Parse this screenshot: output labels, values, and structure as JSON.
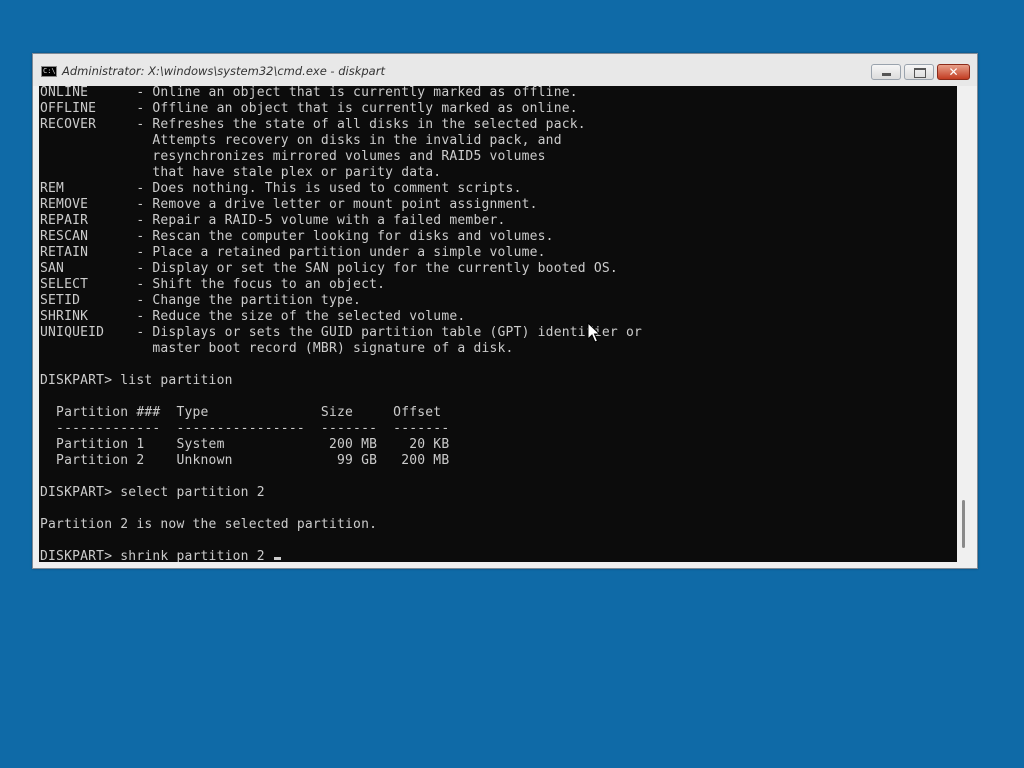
{
  "window": {
    "title": "Administrator: X:\\windows\\system32\\cmd.exe - diskpart",
    "icon_label": "C:\\",
    "close_glyph": "✕"
  },
  "console": {
    "lines": [
      "ONLINE      - Online an object that is currently marked as offline.",
      "OFFLINE     - Offline an object that is currently marked as online.",
      "RECOVER     - Refreshes the state of all disks in the selected pack.",
      "              Attempts recovery on disks in the invalid pack, and",
      "              resynchronizes mirrored volumes and RAID5 volumes",
      "              that have stale plex or parity data.",
      "REM         - Does nothing. This is used to comment scripts.",
      "REMOVE      - Remove a drive letter or mount point assignment.",
      "REPAIR      - Repair a RAID-5 volume with a failed member.",
      "RESCAN      - Rescan the computer looking for disks and volumes.",
      "RETAIN      - Place a retained partition under a simple volume.",
      "SAN         - Display or set the SAN policy for the currently booted OS.",
      "SELECT      - Shift the focus to an object.",
      "SETID       - Change the partition type.",
      "SHRINK      - Reduce the size of the selected volume.",
      "UNIQUEID    - Displays or sets the GUID partition table (GPT) identifier or",
      "              master boot record (MBR) signature of a disk.",
      "",
      "DISKPART> list partition",
      "",
      "  Partition ###  Type              Size     Offset",
      "  -------------  ----------------  -------  -------",
      "  Partition 1    System             200 MB    20 KB",
      "  Partition 2    Unknown             99 GB   200 MB",
      "",
      "DISKPART> select partition 2",
      "",
      "Partition 2 is now the selected partition.",
      ""
    ],
    "prompt_line": "DISKPART> shrink partition 2 "
  },
  "colors": {
    "desktop": "#0f6aa7",
    "console_bg": "#0c0c0c",
    "console_fg": "#cccccc",
    "close_button": "#c23c22"
  },
  "icons": {
    "app": "cmd-icon",
    "minimize": "minimize-icon",
    "maximize": "maximize-icon",
    "close": "close-icon",
    "pointer": "mouse-pointer-icon"
  }
}
